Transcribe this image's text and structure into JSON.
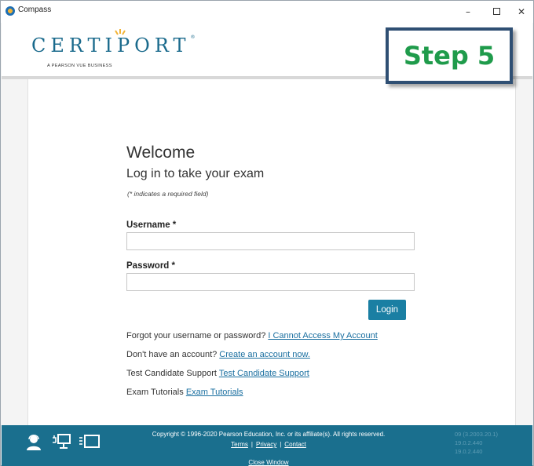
{
  "window": {
    "title": "Compass",
    "minimize_glyph": "–",
    "close_glyph": "✕"
  },
  "header": {
    "logo_text": "CERTIPORT",
    "logo_reg": "®",
    "logo_tagline": "A PEARSON VUE BUSINESS"
  },
  "step_badge": {
    "label": "Step 5",
    "color": "#1f9b4b"
  },
  "login": {
    "welcome": "Welcome",
    "subtitle": "Log in to take your exam",
    "required_note": "(* indicates a required field)",
    "username_label": "Username *",
    "username_value": "",
    "password_label": "Password *",
    "password_value": "",
    "login_button": "Login"
  },
  "links": [
    {
      "prefix": "Forgot your username or password? ",
      "link": "I Cannot Access My Account"
    },
    {
      "prefix": "Don't have an account? ",
      "link": "Create an account now."
    },
    {
      "prefix": "Test Candidate Support ",
      "link": "Test Candidate Support"
    },
    {
      "prefix": "Exam Tutorials ",
      "link": "Exam Tutorials"
    }
  ],
  "footer": {
    "copyright": "Copyright © 1996-2020 Pearson Education, Inc. or its affiliate(s). All rights reserved.",
    "terms": "Terms",
    "privacy": "Privacy",
    "contact": "Contact",
    "separator": "|",
    "close_window": "Close Window",
    "versions": [
      "09 (3.2003.20.1)",
      "19.0.2.440",
      "19.0.2.440"
    ]
  },
  "colors": {
    "brand": "#1a6a8c",
    "footer_bg": "#1a6f8e",
    "login_button": "#1a7fa3",
    "link": "#1a6fa0",
    "badge_border": "#2f4f73"
  }
}
